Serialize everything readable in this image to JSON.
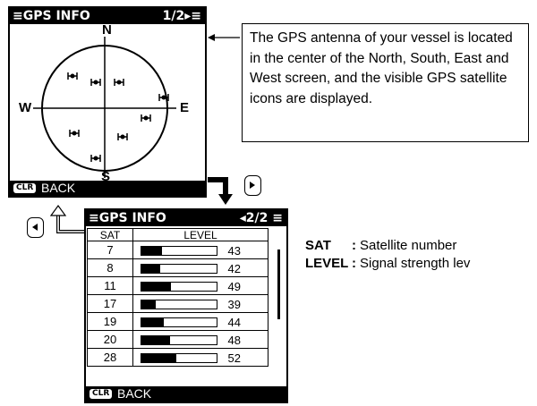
{
  "screen1": {
    "title": "≡GPS INFO",
    "page": "1/2▸≡",
    "compass": {
      "n": "N",
      "s": "S",
      "e": "E",
      "w": "W"
    },
    "footer": {
      "clr": "CLR",
      "back": "BACK"
    }
  },
  "screen2": {
    "title": "≡GPS INFO",
    "page": "◂2/2 ≡",
    "headers": {
      "sat": "SAT",
      "level": "LEVEL"
    },
    "rows": [
      {
        "sat": "7",
        "level": "43"
      },
      {
        "sat": "8",
        "level": "42"
      },
      {
        "sat": "11",
        "level": "49"
      },
      {
        "sat": "17",
        "level": "39"
      },
      {
        "sat": "19",
        "level": "44"
      },
      {
        "sat": "20",
        "level": "48"
      },
      {
        "sat": "28",
        "level": "52"
      }
    ],
    "footer": {
      "clr": "CLR",
      "back": "BACK"
    }
  },
  "callout": {
    "text": "The GPS antenna of your vessel is located in the center of the North, South, East and West screen, and the visible GPS satellite icons are displayed."
  },
  "legend": {
    "sat_term": "SAT",
    "sat_sep": ":",
    "sat_desc": "Satellite number",
    "level_term": "LEVEL",
    "level_sep": ":",
    "level_desc": "Signal strength lev"
  },
  "keys": {
    "right": "right-key-icon",
    "left": "left-key-icon"
  }
}
